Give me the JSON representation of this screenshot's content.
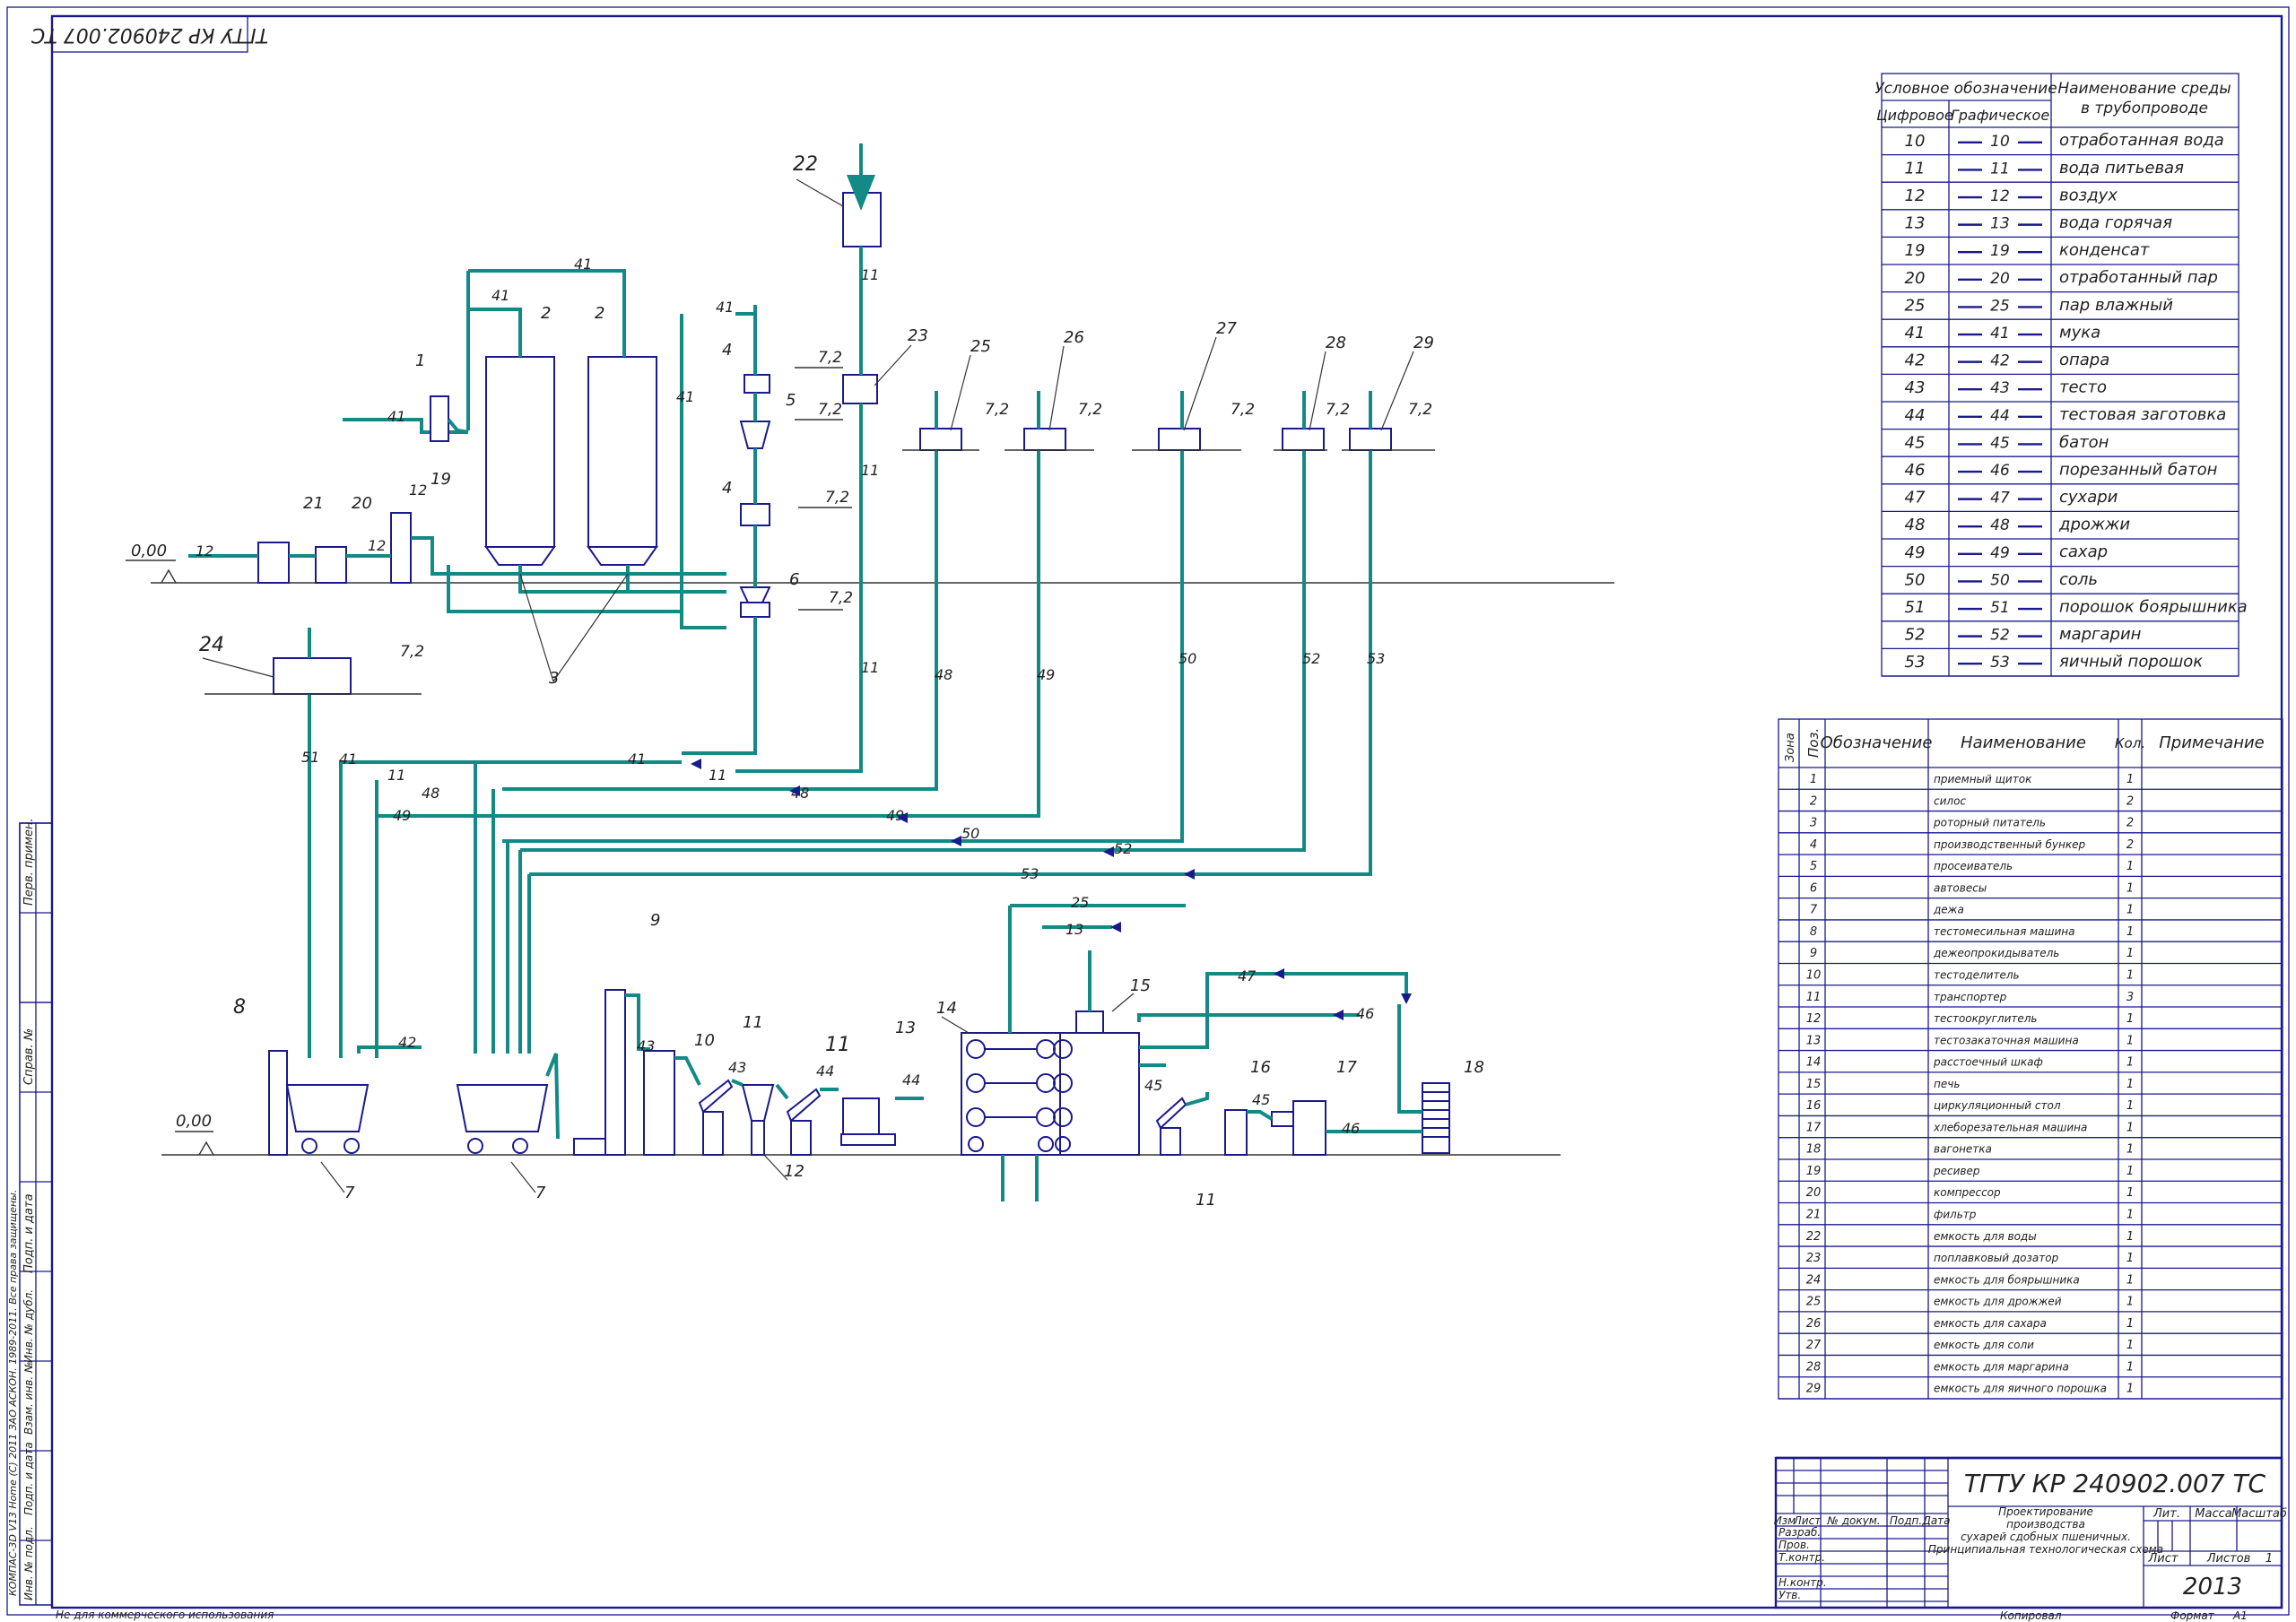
{
  "doc_code": "ТГТУ КР 240902.007 ТС",
  "title_block": {
    "code": "ТГТУ КР 240902.007 ТС",
    "desc_lines": [
      "Проектирование",
      "производства",
      "сухарей сдобных пшеничных.",
      "Принципиальная технологическая схема"
    ],
    "year": "2013",
    "headers": {
      "izm": "Изм",
      "list": "Лист",
      "doc_no": "№ докум.",
      "sign": "Подп.",
      "date": "Дата"
    },
    "roles": [
      "Разраб.",
      "Пров.",
      "Т.контр.",
      "",
      "Н.контр.",
      "Утв."
    ],
    "lit": "Лит.",
    "mass": "Масса",
    "scale": "Масштаб",
    "sheet": "Лист",
    "sheets": "Листов",
    "sheets_count": "1",
    "copied": "Копировал",
    "format": "Формат",
    "format_value": "A1"
  },
  "left_strip": {
    "items": [
      "Перв. примен.",
      "Справ. №",
      "Подп. и дата",
      "Инв. № дубл.",
      "Взам. инв. №",
      "Подп. и дата",
      "Инв. № подл."
    ],
    "software": "КОМПАС-3D V13 Home (C) 2011 ЗАО АСКОН. 1989-2011. Все права защищены."
  },
  "footer_note": "Не для коммерческого использования",
  "legend": {
    "head_cond": "Условное обозначение",
    "head_digit": "Цифровое",
    "head_graph": "Графическое",
    "head_name": [
      "Наименование среды",
      "в трубопроводе"
    ],
    "rows": [
      {
        "code": "10",
        "name": "отработанная вода"
      },
      {
        "code": "11",
        "name": "вода питьевая"
      },
      {
        "code": "12",
        "name": "воздух"
      },
      {
        "code": "13",
        "name": "вода горячая"
      },
      {
        "code": "19",
        "name": "конденсат"
      },
      {
        "code": "20",
        "name": "отработанный пар"
      },
      {
        "code": "25",
        "name": "пар влажный"
      },
      {
        "code": "41",
        "name": "мука"
      },
      {
        "code": "42",
        "name": "опара"
      },
      {
        "code": "43",
        "name": "тесто"
      },
      {
        "code": "44",
        "name": "тестовая заготовка"
      },
      {
        "code": "45",
        "name": "батон"
      },
      {
        "code": "46",
        "name": "порезанный батон"
      },
      {
        "code": "47",
        "name": "сухари"
      },
      {
        "code": "48",
        "name": "дрожжи"
      },
      {
        "code": "49",
        "name": "сахар"
      },
      {
        "code": "50",
        "name": "соль"
      },
      {
        "code": "51",
        "name": "порошок боярышника"
      },
      {
        "code": "52",
        "name": "маргарин"
      },
      {
        "code": "53",
        "name": "яичный порошок"
      }
    ]
  },
  "spec": {
    "head": {
      "zone": "Зона",
      "pos": "Поз.",
      "desig": "Обозначение",
      "name": "Наименование",
      "qty": "Кол.",
      "note": "Примечание"
    },
    "rows": [
      {
        "pos": "1",
        "name": "приемный щиток",
        "qty": "1"
      },
      {
        "pos": "2",
        "name": "силос",
        "qty": "2"
      },
      {
        "pos": "3",
        "name": "роторный питатель",
        "qty": "2"
      },
      {
        "pos": "4",
        "name": "производственный бункер",
        "qty": "2"
      },
      {
        "pos": "5",
        "name": "просеиватель",
        "qty": "1"
      },
      {
        "pos": "6",
        "name": "автовесы",
        "qty": "1"
      },
      {
        "pos": "7",
        "name": "дежа",
        "qty": "1"
      },
      {
        "pos": "8",
        "name": "тестомесильная машина",
        "qty": "1"
      },
      {
        "pos": "9",
        "name": "дежеопрокидыватель",
        "qty": "1"
      },
      {
        "pos": "10",
        "name": "тестоделитель",
        "qty": "1"
      },
      {
        "pos": "11",
        "name": "транспортер",
        "qty": "3"
      },
      {
        "pos": "12",
        "name": "тестоокруглитель",
        "qty": "1"
      },
      {
        "pos": "13",
        "name": "тестозакаточная машина",
        "qty": "1"
      },
      {
        "pos": "14",
        "name": "расстоечный шкаф",
        "qty": "1"
      },
      {
        "pos": "15",
        "name": "печь",
        "qty": "1"
      },
      {
        "pos": "16",
        "name": "циркуляционный стол",
        "qty": "1"
      },
      {
        "pos": "17",
        "name": "хлеборезательная машина",
        "qty": "1"
      },
      {
        "pos": "18",
        "name": "вагонетка",
        "qty": "1"
      },
      {
        "pos": "19",
        "name": "ресивер",
        "qty": "1"
      },
      {
        "pos": "20",
        "name": "компрессор",
        "qty": "1"
      },
      {
        "pos": "21",
        "name": "фильтр",
        "qty": "1"
      },
      {
        "pos": "22",
        "name": "емкость для воды",
        "qty": "1"
      },
      {
        "pos": "23",
        "name": "поплавковый дозатор",
        "qty": "1"
      },
      {
        "pos": "24",
        "name": "емкость для боярышника",
        "qty": "1"
      },
      {
        "pos": "25",
        "name": "емкость для дрожжей",
        "qty": "1"
      },
      {
        "pos": "26",
        "name": "емкость для сахара",
        "qty": "1"
      },
      {
        "pos": "27",
        "name": "емкость для соли",
        "qty": "1"
      },
      {
        "pos": "28",
        "name": "емкость для маргарина",
        "qty": "1"
      },
      {
        "pos": "29",
        "name": "емкость для яичного порошка",
        "qty": "1"
      }
    ]
  },
  "scheme": {
    "levels": {
      "zero": "0,00",
      "upper": "7,2"
    },
    "equipment": [
      "1",
      "2",
      "3",
      "4",
      "5",
      "6",
      "7",
      "8",
      "9",
      "10",
      "11",
      "12",
      "13",
      "14",
      "15",
      "16",
      "17",
      "18",
      "19",
      "20",
      "21",
      "22",
      "23",
      "24",
      "25",
      "26",
      "27",
      "28",
      "29"
    ],
    "lines": [
      "10",
      "11",
      "12",
      "13",
      "19",
      "20",
      "25",
      "41",
      "42",
      "43",
      "44",
      "45",
      "46",
      "47",
      "48",
      "49",
      "50",
      "51",
      "52",
      "53"
    ]
  }
}
